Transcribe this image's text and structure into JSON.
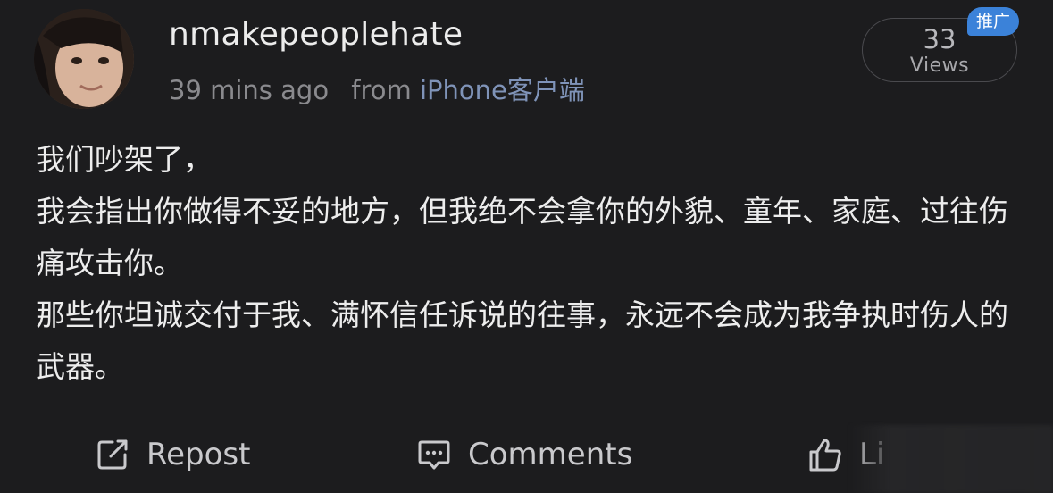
{
  "author": {
    "username": "nmakepeoplehate",
    "time_ago": "39 mins ago",
    "from_prefix": "from",
    "device": "iPhone客户端"
  },
  "stats": {
    "views_count": "33",
    "views_label": "Views",
    "promo_badge": "推广"
  },
  "post": {
    "lines": [
      "我们吵架了，",
      "我会指出你做得不妥的地方，但我绝不会拿你的外貌、童年、家庭、过往伤痛攻击你。",
      "那些你坦诚交付于我、满怀信任诉说的往事，永远不会成为我争执时伤人的武器。"
    ]
  },
  "actions": {
    "repost_label": "Repost",
    "comments_label": "Comments",
    "like_label": "Li"
  },
  "colors": {
    "background": "#1c1c1e",
    "device_link": "#7f93b8",
    "badge": "#3b82d9"
  }
}
